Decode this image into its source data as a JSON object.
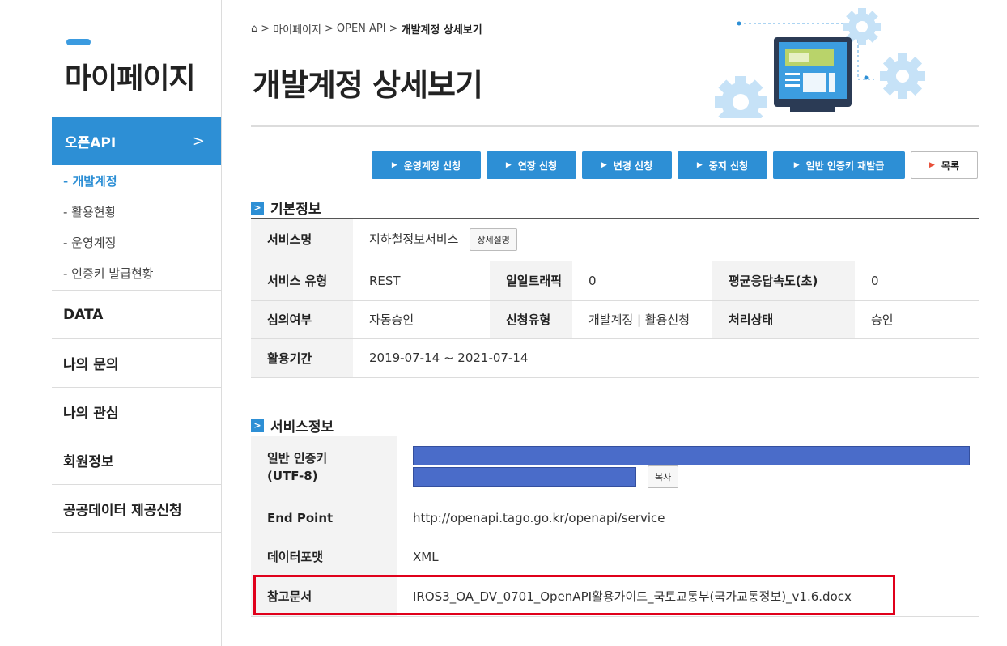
{
  "sidebar": {
    "title": "마이페이지",
    "active_section": "오픈API",
    "active_chevron": ">",
    "sub_items": [
      "- 개발계정",
      "- 활용현황",
      "- 운영계정",
      "- 인증키 발급현황"
    ],
    "items": [
      "DATA",
      "나의 문의",
      "나의 관심",
      "회원정보",
      "공공데이터 제공신청"
    ]
  },
  "breadcrumb": {
    "home_icon": "home-icon",
    "items": [
      "마이페이지",
      "OPEN API",
      "개발계정 상세보기"
    ],
    "separator": ">"
  },
  "page_title": "개발계정 상세보기",
  "actions": {
    "btn1": "운영계정 신청",
    "btn2": "연장 신청",
    "btn3": "변경 신청",
    "btn4": "중지 신청",
    "btn5": "일반 인증키 재발급",
    "btn6": "목록"
  },
  "basic_info": {
    "heading": "기본정보",
    "service_name_label": "서비스명",
    "service_name": "지하철정보서비스",
    "detail_button": "상세설명",
    "service_type_label": "서비스 유형",
    "service_type": "REST",
    "daily_traffic_label": "일일트래픽",
    "daily_traffic": "0",
    "avg_response_label": "평균응답속도(초)",
    "avg_response": "0",
    "review_label": "심의여부",
    "review": "자동승인",
    "request_type_label": "신청유형",
    "request_type": "개발계정 | 활용신청",
    "status_label": "처리상태",
    "status": "승인",
    "period_label": "활용기간",
    "period": "2019-07-14 ~ 2021-07-14"
  },
  "service_info": {
    "heading": "서비스정보",
    "key_label_1": "일반 인증키",
    "key_label_2": "(UTF-8)",
    "copy_button": "복사",
    "endpoint_label": "End Point",
    "endpoint": "http://openapi.tago.go.kr/openapi/service",
    "format_label": "데이터포맷",
    "format": "XML",
    "reference_label": "참고문서",
    "reference": "IROS3_OA_DV_0701_OpenAPI활용가이드_국토교통부(국가교통정보)_v1.6.docx"
  },
  "colors": {
    "accent": "#2d8fd5",
    "highlight": "#e0001b",
    "redacted": "#4a6cc9"
  }
}
